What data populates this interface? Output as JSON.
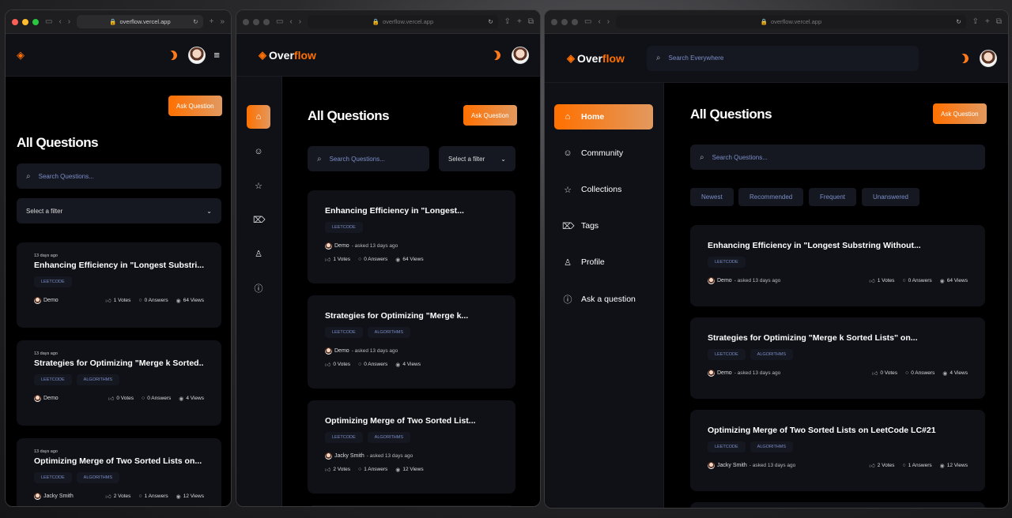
{
  "url": "overflow.vercel.app",
  "brand": {
    "name_a": "Over",
    "name_b": "flow"
  },
  "page_title": "All Questions",
  "ask_button": "Ask Question",
  "search_placeholder": "Search Questions...",
  "global_search_placeholder": "Search Everywhere",
  "filter_label": "Select a filter",
  "filters": [
    "Newest",
    "Recommended",
    "Frequent",
    "Unanswered"
  ],
  "sidebar": [
    "Home",
    "Community",
    "Collections",
    "Tags",
    "Profile",
    "Ask a question"
  ],
  "colors": {
    "accent": "#ff7000",
    "card": "#0f1117",
    "bg": "#000000",
    "muted": "#7b8ec8"
  },
  "questions": [
    {
      "date": "13 days ago",
      "title_full": "Enhancing Efficiency in \"Longest Substring Without...",
      "title_short": "Enhancing Efficiency in \"Longest Substri...",
      "title_mid": "Enhancing Efficiency in \"Longest...",
      "tags": [
        "LEETCODE"
      ],
      "author": "Demo",
      "asked": "- asked 13 days ago",
      "votes": "1 Votes",
      "answers": "0 Answers",
      "views": "64 Views"
    },
    {
      "date": "13 days ago",
      "title_full": "Strategies for Optimizing \"Merge k Sorted Lists\" on...",
      "title_short": "Strategies for Optimizing \"Merge k Sorted...",
      "title_mid": "Strategies for Optimizing \"Merge k...",
      "tags": [
        "LEETCODE",
        "ALGORITHMS"
      ],
      "author": "Demo",
      "asked": "- asked 13 days ago",
      "votes": "0 Votes",
      "answers": "0 Answers",
      "views": "4 Views"
    },
    {
      "date": "13 days ago",
      "title_full": "Optimizing Merge of Two Sorted Lists on LeetCode LC#21",
      "title_short": "Optimizing Merge of Two Sorted Lists on...",
      "title_mid": "Optimizing Merge of Two Sorted List...",
      "tags": [
        "LEETCODE",
        "ALGORITHMS"
      ],
      "author": "Jacky Smith",
      "asked": "- asked 13 days ago",
      "votes": "2 Votes",
      "answers": "1 Answers",
      "views": "12 Views"
    }
  ]
}
